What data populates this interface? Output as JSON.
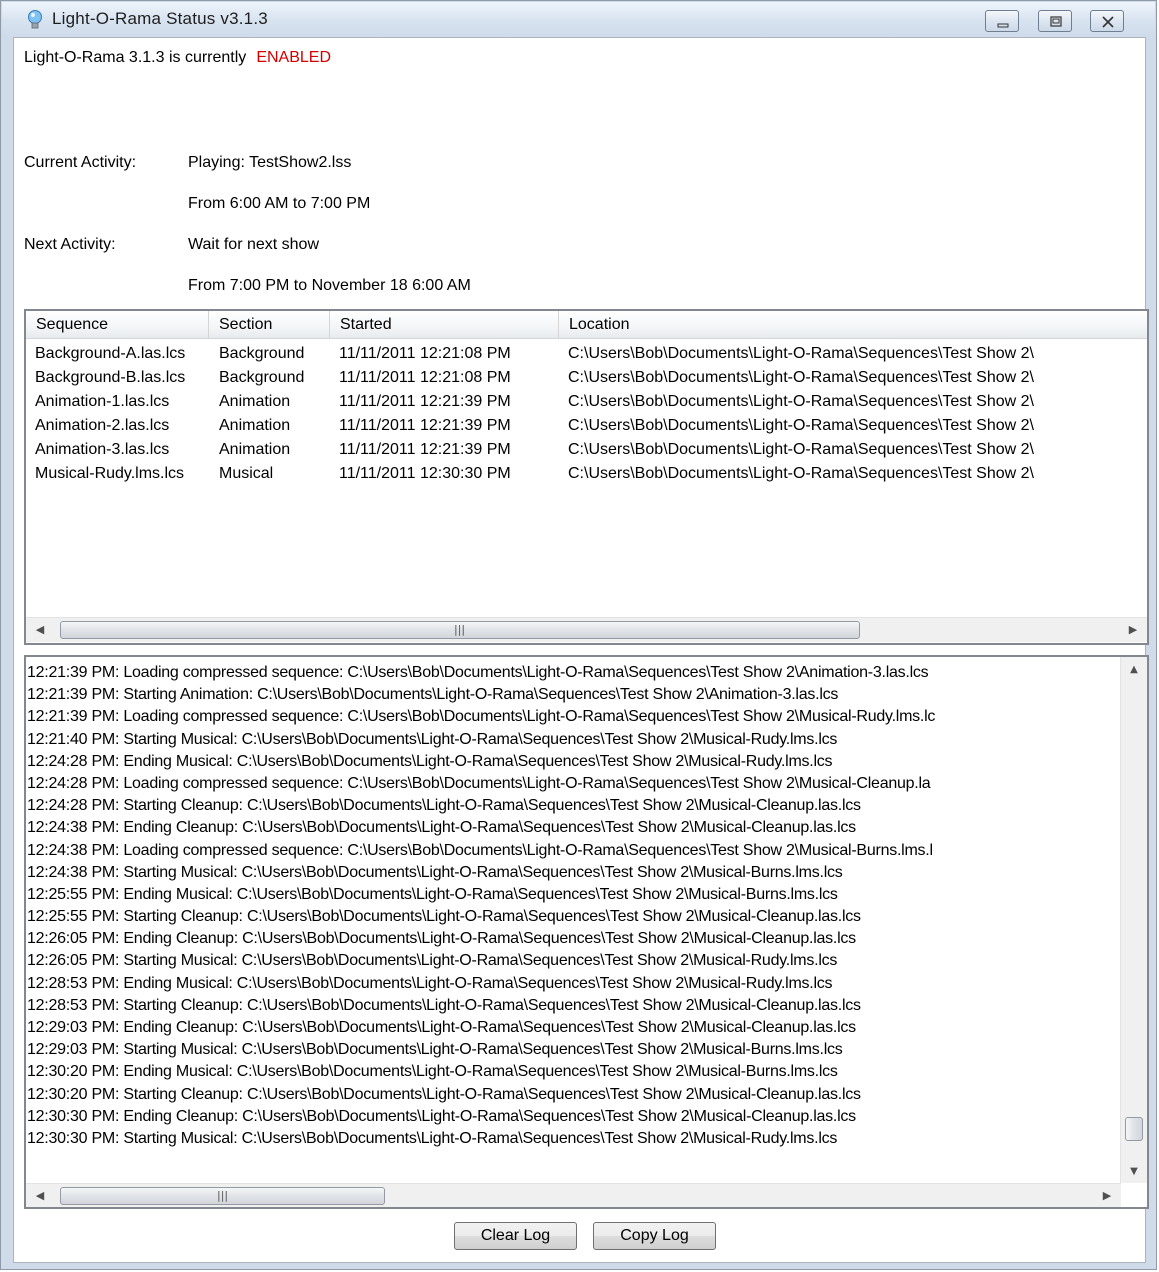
{
  "window": {
    "title": "Light-O-Rama Status v3.1.3"
  },
  "status": {
    "prefix": "Light-O-Rama 3.1.3 is currently",
    "state": "ENABLED",
    "state_color": "#d40000"
  },
  "activity": {
    "current_label": "Current Activity:",
    "current_value": "Playing: TestShow2.lss",
    "current_time": "From 6:00 AM to 7:00 PM",
    "next_label": "Next Activity:",
    "next_value": "Wait for next show",
    "next_time": "From 7:00 PM to November 18 6:00 AM"
  },
  "sequences": {
    "columns": [
      "Sequence",
      "Section",
      "Started",
      "Location"
    ],
    "rows": [
      [
        "Background-A.las.lcs",
        "Background",
        "11/11/2011 12:21:08 PM",
        "C:\\Users\\Bob\\Documents\\Light-O-Rama\\Sequences\\Test Show 2\\"
      ],
      [
        "Background-B.las.lcs",
        "Background",
        "11/11/2011 12:21:08 PM",
        "C:\\Users\\Bob\\Documents\\Light-O-Rama\\Sequences\\Test Show 2\\"
      ],
      [
        "Animation-1.las.lcs",
        "Animation",
        "11/11/2011 12:21:39 PM",
        "C:\\Users\\Bob\\Documents\\Light-O-Rama\\Sequences\\Test Show 2\\"
      ],
      [
        "Animation-2.las.lcs",
        "Animation",
        "11/11/2011 12:21:39 PM",
        "C:\\Users\\Bob\\Documents\\Light-O-Rama\\Sequences\\Test Show 2\\"
      ],
      [
        "Animation-3.las.lcs",
        "Animation",
        "11/11/2011 12:21:39 PM",
        "C:\\Users\\Bob\\Documents\\Light-O-Rama\\Sequences\\Test Show 2\\"
      ],
      [
        "Musical-Rudy.lms.lcs",
        "Musical",
        "11/11/2011 12:30:30 PM",
        "C:\\Users\\Bob\\Documents\\Light-O-Rama\\Sequences\\Test Show 2\\"
      ]
    ]
  },
  "log": {
    "lines": [
      "12:21:39 PM: Loading compressed sequence: C:\\Users\\Bob\\Documents\\Light-O-Rama\\Sequences\\Test Show 2\\Animation-3.las.lcs",
      "12:21:39 PM: Starting Animation: C:\\Users\\Bob\\Documents\\Light-O-Rama\\Sequences\\Test Show 2\\Animation-3.las.lcs",
      "12:21:39 PM: Loading compressed sequence: C:\\Users\\Bob\\Documents\\Light-O-Rama\\Sequences\\Test Show 2\\Musical-Rudy.lms.lc",
      "12:21:40 PM: Starting Musical: C:\\Users\\Bob\\Documents\\Light-O-Rama\\Sequences\\Test Show 2\\Musical-Rudy.lms.lcs",
      "12:24:28 PM: Ending Musical: C:\\Users\\Bob\\Documents\\Light-O-Rama\\Sequences\\Test Show 2\\Musical-Rudy.lms.lcs",
      "12:24:28 PM: Loading compressed sequence: C:\\Users\\Bob\\Documents\\Light-O-Rama\\Sequences\\Test Show 2\\Musical-Cleanup.la",
      "12:24:28 PM: Starting Cleanup: C:\\Users\\Bob\\Documents\\Light-O-Rama\\Sequences\\Test Show 2\\Musical-Cleanup.las.lcs",
      "12:24:38 PM: Ending Cleanup: C:\\Users\\Bob\\Documents\\Light-O-Rama\\Sequences\\Test Show 2\\Musical-Cleanup.las.lcs",
      "12:24:38 PM: Loading compressed sequence: C:\\Users\\Bob\\Documents\\Light-O-Rama\\Sequences\\Test Show 2\\Musical-Burns.lms.l",
      "12:24:38 PM: Starting Musical: C:\\Users\\Bob\\Documents\\Light-O-Rama\\Sequences\\Test Show 2\\Musical-Burns.lms.lcs",
      "12:25:55 PM: Ending Musical: C:\\Users\\Bob\\Documents\\Light-O-Rama\\Sequences\\Test Show 2\\Musical-Burns.lms.lcs",
      "12:25:55 PM: Starting Cleanup: C:\\Users\\Bob\\Documents\\Light-O-Rama\\Sequences\\Test Show 2\\Musical-Cleanup.las.lcs",
      "12:26:05 PM: Ending Cleanup: C:\\Users\\Bob\\Documents\\Light-O-Rama\\Sequences\\Test Show 2\\Musical-Cleanup.las.lcs",
      "12:26:05 PM: Starting Musical: C:\\Users\\Bob\\Documents\\Light-O-Rama\\Sequences\\Test Show 2\\Musical-Rudy.lms.lcs",
      "12:28:53 PM: Ending Musical: C:\\Users\\Bob\\Documents\\Light-O-Rama\\Sequences\\Test Show 2\\Musical-Rudy.lms.lcs",
      "12:28:53 PM: Starting Cleanup: C:\\Users\\Bob\\Documents\\Light-O-Rama\\Sequences\\Test Show 2\\Musical-Cleanup.las.lcs",
      "12:29:03 PM: Ending Cleanup: C:\\Users\\Bob\\Documents\\Light-O-Rama\\Sequences\\Test Show 2\\Musical-Cleanup.las.lcs",
      "12:29:03 PM: Starting Musical: C:\\Users\\Bob\\Documents\\Light-O-Rama\\Sequences\\Test Show 2\\Musical-Burns.lms.lcs",
      "12:30:20 PM: Ending Musical: C:\\Users\\Bob\\Documents\\Light-O-Rama\\Sequences\\Test Show 2\\Musical-Burns.lms.lcs",
      "12:30:20 PM: Starting Cleanup: C:\\Users\\Bob\\Documents\\Light-O-Rama\\Sequences\\Test Show 2\\Musical-Cleanup.las.lcs",
      "12:30:30 PM: Ending Cleanup: C:\\Users\\Bob\\Documents\\Light-O-Rama\\Sequences\\Test Show 2\\Musical-Cleanup.las.lcs",
      "12:30:30 PM: Starting Musical: C:\\Users\\Bob\\Documents\\Light-O-Rama\\Sequences\\Test Show 2\\Musical-Rudy.lms.lcs"
    ]
  },
  "buttons": {
    "clear_log": "Clear Log",
    "copy_log": "Copy Log"
  },
  "icons": {
    "app": "lightbulb-icon",
    "minimize": "minimize-icon",
    "maximize": "maximize-icon",
    "close": "close-icon"
  }
}
